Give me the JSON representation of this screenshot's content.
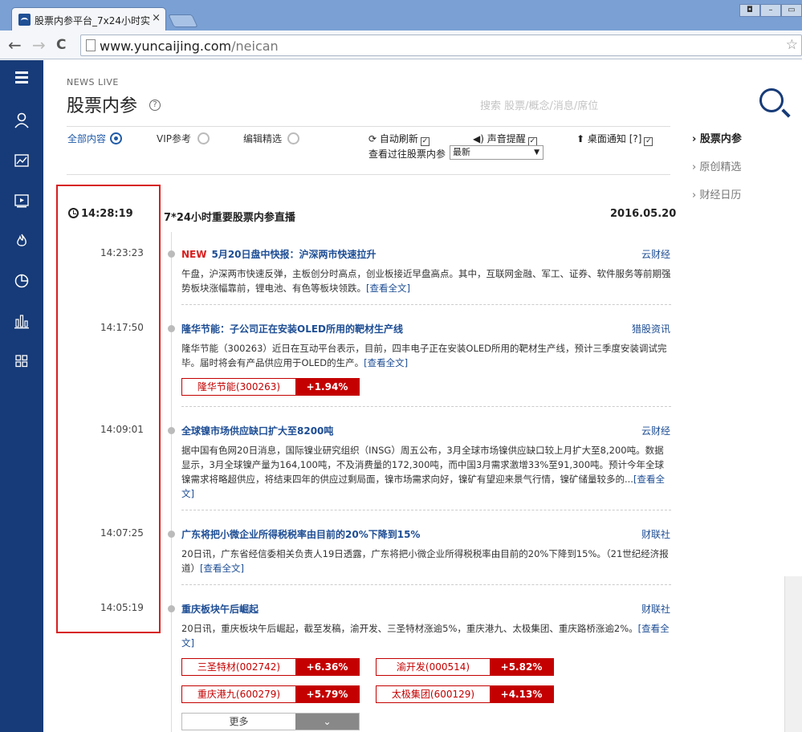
{
  "browser": {
    "tab_title": "股票内参平台_7x24小时实",
    "tab_close": "×",
    "url_host": "www.yuncaijing.com",
    "url_path": "/neican",
    "back_glyph": "←",
    "forward_glyph": "→",
    "reload_glyph": "C",
    "star_glyph": "☆"
  },
  "leftbar": {
    "icons": [
      "menu-icon",
      "user-icon",
      "chart-icon",
      "video-icon",
      "flame-icon",
      "pie-chart-icon",
      "bar-chart-icon",
      "grid-icon"
    ],
    "accent_color": "#173b78"
  },
  "header": {
    "kicker": "NEWS LIVE",
    "title": "股票内参",
    "help": "?",
    "search_placeholder": "搜索 股票/概念/消息/席位"
  },
  "filters": {
    "all": "全部内容",
    "vip": "VIP参考",
    "editor": "编辑精选",
    "auto_refresh": "自动刷新",
    "sound": "声音提醒",
    "desktop": "桌面通知 [?]",
    "past_label": "查看过往股票内参",
    "past_select": "最新"
  },
  "right_nav": [
    {
      "label": "股票内参",
      "active": true
    },
    {
      "label": "原创精选",
      "active": false
    },
    {
      "label": "财经日历",
      "active": false
    }
  ],
  "timeline": {
    "current_time": "14:28:19",
    "title": "7*24小时重要股票内参直播",
    "date": "2016.05.20",
    "more_label": "更多",
    "items": [
      {
        "time": "14:23:23",
        "badge": "NEW",
        "headline": "5月20日盘中快报：沪深两市快速拉升",
        "source": "云财经",
        "body": "午盘，沪深两市快速反弹，主板创分时高点，创业板接近早盘高点。其中，互联网金融、军工、证券、软件服务等前期强势板块涨幅靠前，锂电池、有色等板块领跌。",
        "more": "[查看全文]"
      },
      {
        "time": "14:17:50",
        "headline": "隆华节能：子公司正在安装OLED所用的靶材生产线",
        "source": "猎股资讯",
        "body": "隆华节能（300263）近日在互动平台表示，目前，四丰电子正在安装OLED所用的靶材生产线，预计三季度安装调试完毕。届时将会有产品供应用于OLED的生产。",
        "more": "[查看全文]",
        "stocks": [
          {
            "name": "隆华节能(300263)",
            "pct": "+1.94%"
          }
        ]
      },
      {
        "time": "14:09:01",
        "headline": "全球镍市场供应缺口扩大至8200吨",
        "source": "云财经",
        "body": "据中国有色网20日消息，国际镍业研究组织（INSG）周五公布，3月全球市场镍供应缺口较上月扩大至8,200吨。数据显示，3月全球镍产量为164,100吨，不及消费量的172,300吨，而中国3月需求激增33%至91,300吨。预计今年全球镍需求将略超供应，将结束四年的供应过剩局面，镍市场需求向好，镍矿有望迎来景气行情，镍矿储量较多的...",
        "more": "[查看全文]"
      },
      {
        "time": "14:07:25",
        "headline": "广东将把小微企业所得税税率由目前的20%下降到15%",
        "source": "财联社",
        "body": "20日讯，广东省经信委相关负责人19日透露，广东将把小微企业所得税税率由目前的20%下降到15%。（21世纪经济报道）",
        "more": "[查看全文]"
      },
      {
        "time": "14:05:19",
        "headline": "重庆板块午后崛起",
        "source": "财联社",
        "body": "20日讯，重庆板块午后崛起，截至发稿，渝开发、三圣特材涨逾5%，重庆港九、太极集团、重庆路桥涨逾2%。",
        "more": "[查看全文]",
        "stocks": [
          {
            "name": "三圣特材(002742)",
            "pct": "+6.36%"
          },
          {
            "name": "渝开发(000514)",
            "pct": "+5.82%"
          },
          {
            "name": "重庆港九(600279)",
            "pct": "+5.79%"
          },
          {
            "name": "太极集团(600129)",
            "pct": "+4.13%"
          }
        ]
      }
    ]
  }
}
